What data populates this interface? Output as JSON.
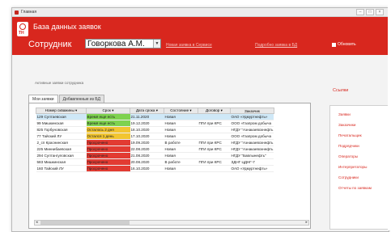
{
  "window": {
    "title": "Главная"
  },
  "header": {
    "app_title": "База данных заявок",
    "employee_label": "Сотрудник",
    "employee_value": "Говоркова А.М.",
    "link1": "Новая заявка в Сервисе",
    "link2": "Подробно заявка в БД",
    "refresh_label": "Обновить"
  },
  "active_label": "Активные заявки сотрудника",
  "tabs": [
    "Мои заявки",
    "Добавленные из БД"
  ],
  "table": {
    "columns": [
      "Номер скважины",
      "Срок",
      "Дата срока",
      "Состояние",
      "Договор",
      "Заказчик"
    ],
    "rows": [
      {
        "num": "129 Султаевская",
        "term": "Время еще есть",
        "date": "21.11.2020",
        "state": "Новая",
        "contract": "",
        "customer": "ОАО «Удмуртнефть»"
      },
      {
        "num": "99 Мишкинская",
        "term": "Время еще есть",
        "date": "19.12.2020",
        "state": "Новая",
        "contract": "ПГИ при КРС",
        "customer": "ООО «Газпром добыча"
      },
      {
        "num": "825 Горбуновская",
        "term": "Осталось 2 дня",
        "date": "18.10.2020",
        "state": "Новая",
        "contract": "",
        "customer": "НГДУ \"Азнакаевскнефть"
      },
      {
        "num": "77 Тайский ЛУ",
        "term": "Остался 1 день",
        "date": "17.10.2020",
        "state": "Новая",
        "contract": "",
        "customer": "ООО «Газпром добыча"
      },
      {
        "num": "2_сп Краснинская",
        "term": "Просрочено",
        "date": "19.09.2020",
        "state": "В работе",
        "contract": "ПГИ при КРС",
        "customer": "НГДУ \"Азнакаевскнефть"
      },
      {
        "num": "225 Миннибаевская",
        "term": "Просрочено",
        "date": "22.08.2020",
        "state": "Новая",
        "contract": "ПГИ при КРС",
        "customer": "НГДУ \"Азнакаевскнефть"
      },
      {
        "num": "294 Султангуловская",
        "term": "Просрочено",
        "date": "21.08.2020",
        "state": "Новая",
        "contract": "",
        "customer": "НГДУ \"Бавлынефть\""
      },
      {
        "num": "583 Мишкинская",
        "term": "Просрочено",
        "date": "20.08.2020",
        "state": "В работе",
        "contract": "ПГИ при КРС",
        "customer": "ЗДНГ ЦДНГ-7"
      },
      {
        "num": "160 Тайский ЛУ",
        "term": "Просрочено",
        "date": "16.10.2020",
        "state": "Новая",
        "contract": "",
        "customer": "ОАО «Удмуртнефть»"
      }
    ]
  },
  "term_colors": {
    "Время еще есть": "#7ed24f",
    "Осталось 2 дня": "#f2c531",
    "Остался 1 день": "#f2c531",
    "Просрочено": "#e23b32"
  },
  "refs": {
    "title": "Ссылки",
    "items": [
      "Заявки",
      "Заказчики",
      "Печатальщик",
      "Подрядчики",
      "Операторы",
      "Интерпретаторы",
      "Сотрудники",
      "Отчеты по заявкам"
    ]
  }
}
